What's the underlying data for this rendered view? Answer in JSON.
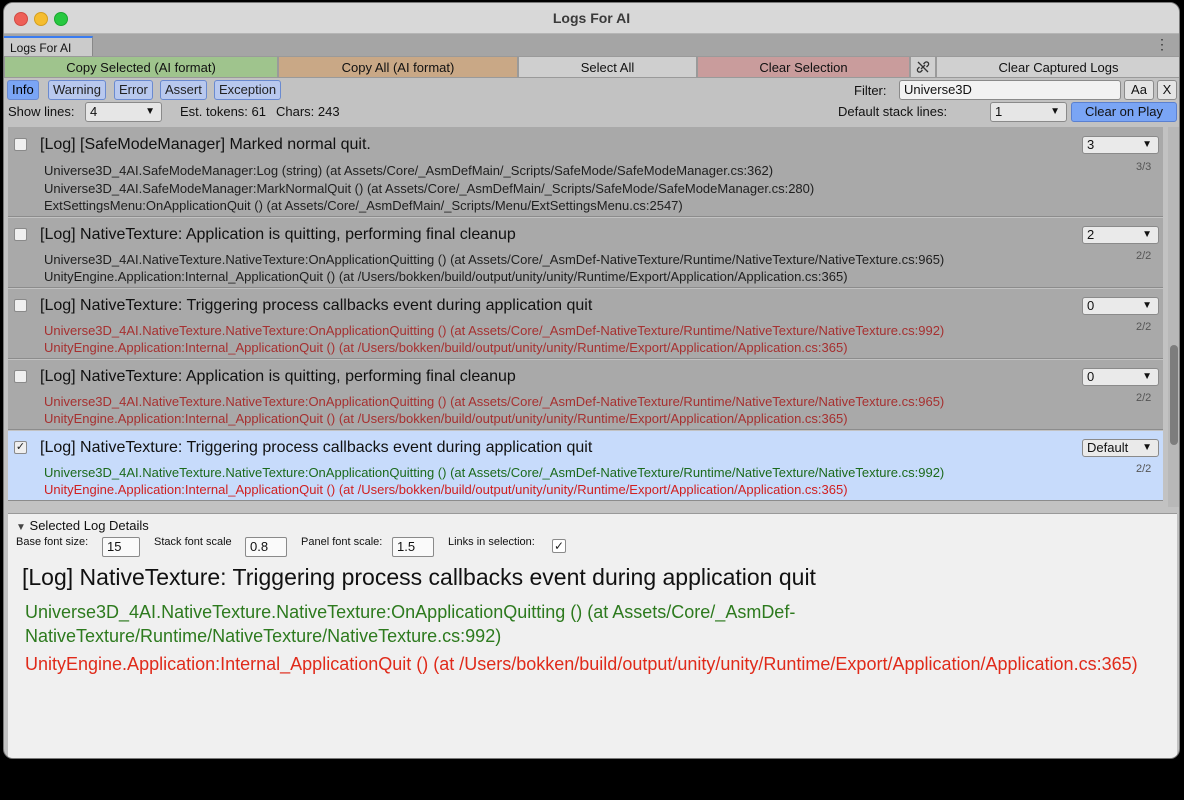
{
  "window": {
    "title": "Logs For AI"
  },
  "tab": {
    "label": "Logs For AI",
    "menu_icon": "kebab-menu-icon"
  },
  "toolbar": {
    "copy_selected": "Copy Selected (AI format)",
    "copy_all": "Copy All (AI format)",
    "select_all": "Select All",
    "clear_selection": "Clear Selection",
    "link_icon": "link-icon",
    "clear_captured": "Clear Captured Logs",
    "colors": {
      "copy_selected": "#9fc48d",
      "copy_all": "#c9a886",
      "select_all": "#cfcfcf",
      "clear_selection": "#c99c9c",
      "clear_captured": "#d0d0d0"
    }
  },
  "levels": [
    {
      "label": "Info",
      "active": true
    },
    {
      "label": "Warning",
      "active": false
    },
    {
      "label": "Error",
      "active": false
    },
    {
      "label": "Assert",
      "active": false
    },
    {
      "label": "Exception",
      "active": false
    }
  ],
  "filter": {
    "label": "Filter:",
    "value": "Universe3D",
    "case_button": "Aa",
    "clear_button": "X"
  },
  "show_lines": {
    "label": "Show lines:",
    "value": "4"
  },
  "stats": {
    "tokens": "Est. tokens: 61",
    "chars": "Chars: 243"
  },
  "stack_lines": {
    "label": "Default stack lines:",
    "value": "1"
  },
  "clear_on_play": "Clear on Play",
  "entries": [
    {
      "title": "[Log] [SafeModeManager] Marked normal quit.",
      "checked": false,
      "selected": false,
      "stack_value": "3",
      "count": "3/3",
      "lines": [
        {
          "text": "Universe3D_4AI.SafeModeManager:Log (string) (at Assets/Core/_AsmDefMain/_Scripts/SafeMode/SafeModeManager.cs:362)",
          "style": "def"
        },
        {
          "text": "Universe3D_4AI.SafeModeManager:MarkNormalQuit () (at Assets/Core/_AsmDefMain/_Scripts/SafeMode/SafeModeManager.cs:280)",
          "style": "def"
        },
        {
          "text": "ExtSettingsMenu:OnApplicationQuit () (at Assets/Core/_AsmDefMain/_Scripts/Menu/ExtSettingsMenu.cs:2547)",
          "style": "def"
        }
      ]
    },
    {
      "title": "[Log] NativeTexture: Application is quitting, performing final cleanup",
      "checked": false,
      "selected": false,
      "stack_value": "2",
      "count": "2/2",
      "lines": [
        {
          "text": "Universe3D_4AI.NativeTexture.NativeTexture:OnApplicationQuitting () (at Assets/Core/_AsmDef-NativeTexture/Runtime/NativeTexture/NativeTexture.cs:965)",
          "style": "def"
        },
        {
          "text": "UnityEngine.Application:Internal_ApplicationQuit () (at /Users/bokken/build/output/unity/unity/Runtime/Export/Application/Application.cs:365)",
          "style": "def"
        }
      ]
    },
    {
      "title": "[Log] NativeTexture: Triggering process callbacks event during application quit",
      "checked": false,
      "selected": false,
      "stack_value": "0",
      "count": "2/2",
      "lines": [
        {
          "text": "Universe3D_4AI.NativeTexture.NativeTexture:OnApplicationQuitting () (at Assets/Core/_AsmDef-NativeTexture/Runtime/NativeTexture/NativeTexture.cs:992)",
          "style": "red"
        },
        {
          "text": "UnityEngine.Application:Internal_ApplicationQuit () (at /Users/bokken/build/output/unity/unity/Runtime/Export/Application/Application.cs:365)",
          "style": "red"
        }
      ]
    },
    {
      "title": "[Log] NativeTexture: Application is quitting, performing final cleanup",
      "checked": false,
      "selected": false,
      "stack_value": "0",
      "count": "2/2",
      "lines": [
        {
          "text": "Universe3D_4AI.NativeTexture.NativeTexture:OnApplicationQuitting () (at Assets/Core/_AsmDef-NativeTexture/Runtime/NativeTexture/NativeTexture.cs:965)",
          "style": "red"
        },
        {
          "text": "UnityEngine.Application:Internal_ApplicationQuit () (at /Users/bokken/build/output/unity/unity/Runtime/Export/Application/Application.cs:365)",
          "style": "red"
        }
      ]
    },
    {
      "title": "[Log] NativeTexture: Triggering process callbacks event during application quit",
      "checked": true,
      "selected": true,
      "stack_value": "Default",
      "count": "2/2",
      "lines": [
        {
          "text": "Universe3D_4AI.NativeTexture.NativeTexture:OnApplicationQuitting () (at Assets/Core/_AsmDef-NativeTexture/Runtime/NativeTexture/NativeTexture.cs:992)",
          "style": "green"
        },
        {
          "text": "UnityEngine.Application:Internal_ApplicationQuit () (at /Users/bokken/build/output/unity/unity/Runtime/Export/Application/Application.cs:365)",
          "style": "red2"
        }
      ]
    }
  ],
  "details": {
    "header": "Selected Log Details",
    "base_font_label": "Base font size:",
    "base_font_value": "15",
    "stack_scale_label": "Stack font scale",
    "stack_scale_value": "0.8",
    "panel_scale_label": "Panel font scale:",
    "panel_scale_value": "1.5",
    "links_label": "Links in selection:",
    "links_checked": true,
    "title": "[Log] NativeTexture: Triggering process callbacks event during application quit",
    "line1": "Universe3D_4AI.NativeTexture.NativeTexture:OnApplicationQuitting () (at Assets/Core/_AsmDef-NativeTexture/Runtime/NativeTexture/NativeTexture.cs:992)",
    "line2": "UnityEngine.Application:Internal_ApplicationQuit () (at /Users/bokken/build/output/unity/unity/Runtime/Export/Application/Application.cs:365)"
  }
}
